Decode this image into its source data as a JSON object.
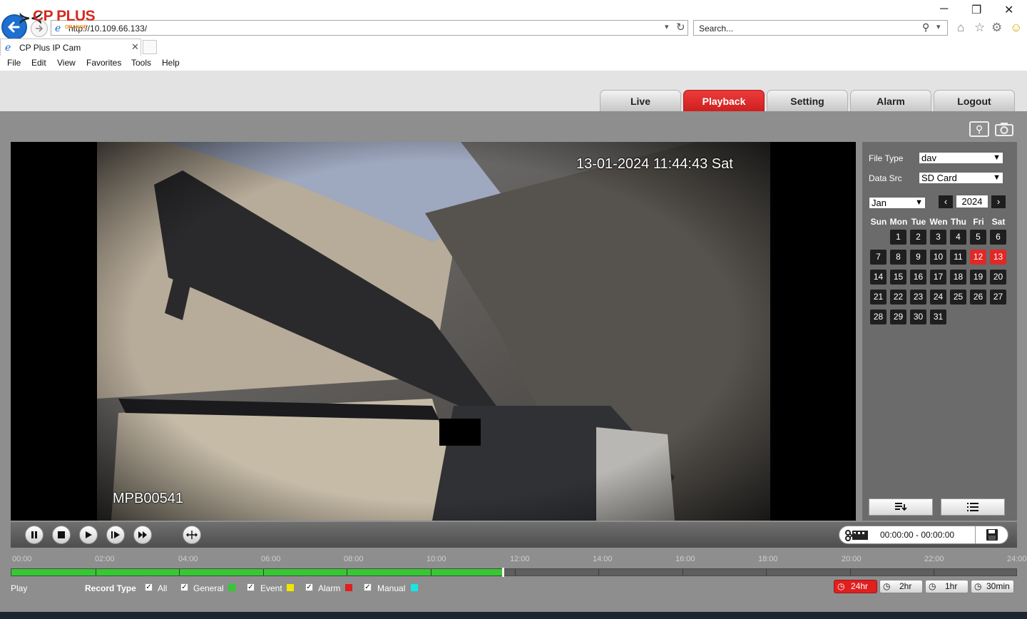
{
  "browser": {
    "url": "http://10.109.66.133/",
    "search_placeholder": "Search...",
    "tab_title": "CP Plus IP Cam",
    "menu": [
      "File",
      "Edit",
      "View",
      "Favorites",
      "Tools",
      "Help"
    ],
    "window_controls": {
      "minimize": "─",
      "restore": "❐",
      "close": "✕"
    }
  },
  "app": {
    "logo": "CP PLUS",
    "logo_sub": "ORANGE",
    "nav_tabs": [
      {
        "label": "Live",
        "active": false
      },
      {
        "label": "Playback",
        "active": true
      },
      {
        "label": "Setting",
        "active": false
      },
      {
        "label": "Alarm",
        "active": false
      },
      {
        "label": "Logout",
        "active": false
      }
    ]
  },
  "video": {
    "osd_timestamp": "13-01-2024 11:44:43 Sat",
    "osd_camera_name": "MPB00541"
  },
  "search_panel": {
    "file_type_label": "File Type",
    "file_type_value": "dav",
    "data_src_label": "Data Src",
    "data_src_value": "SD Card",
    "month": "Jan",
    "year": "2024",
    "weekdays": [
      "Sun",
      "Mon",
      "Tue",
      "Wen",
      "Thu",
      "Fri",
      "Sat"
    ],
    "first_day_offset": 1,
    "days_in_month": 31,
    "recorded_days": [
      12,
      13
    ]
  },
  "controls": {
    "clip_range": "00:00:00 - 00:00:00",
    "buttons": [
      "pause",
      "stop",
      "play",
      "step-forward",
      "fast-forward",
      "zoom-fit"
    ]
  },
  "timeline": {
    "hour_labels": [
      "00:00",
      "02:00",
      "04:00",
      "06:00",
      "08:00",
      "10:00",
      "12:00",
      "14:00",
      "16:00",
      "18:00",
      "20:00",
      "22:00",
      "24:00"
    ],
    "recorded_until_hour": 11.75,
    "cursor_hour": 11.7
  },
  "legend": {
    "play_label": "Play",
    "record_type_label": "Record Type",
    "types": [
      {
        "label": "All",
        "checked": true,
        "color": ""
      },
      {
        "label": "General",
        "checked": true,
        "color": "#35c832"
      },
      {
        "label": "Event",
        "checked": true,
        "color": "#f2e600"
      },
      {
        "label": "Alarm",
        "checked": true,
        "color": "#e01f1f"
      },
      {
        "label": "Manual",
        "checked": true,
        "color": "#17e6e6"
      }
    ],
    "zoom_options": [
      {
        "label": "24hr",
        "active": true
      },
      {
        "label": "2hr",
        "active": false
      },
      {
        "label": "1hr",
        "active": false
      },
      {
        "label": "30min",
        "active": false
      }
    ]
  },
  "colors": {
    "accent_red": "#d52b1e",
    "record_green": "#35c832"
  }
}
